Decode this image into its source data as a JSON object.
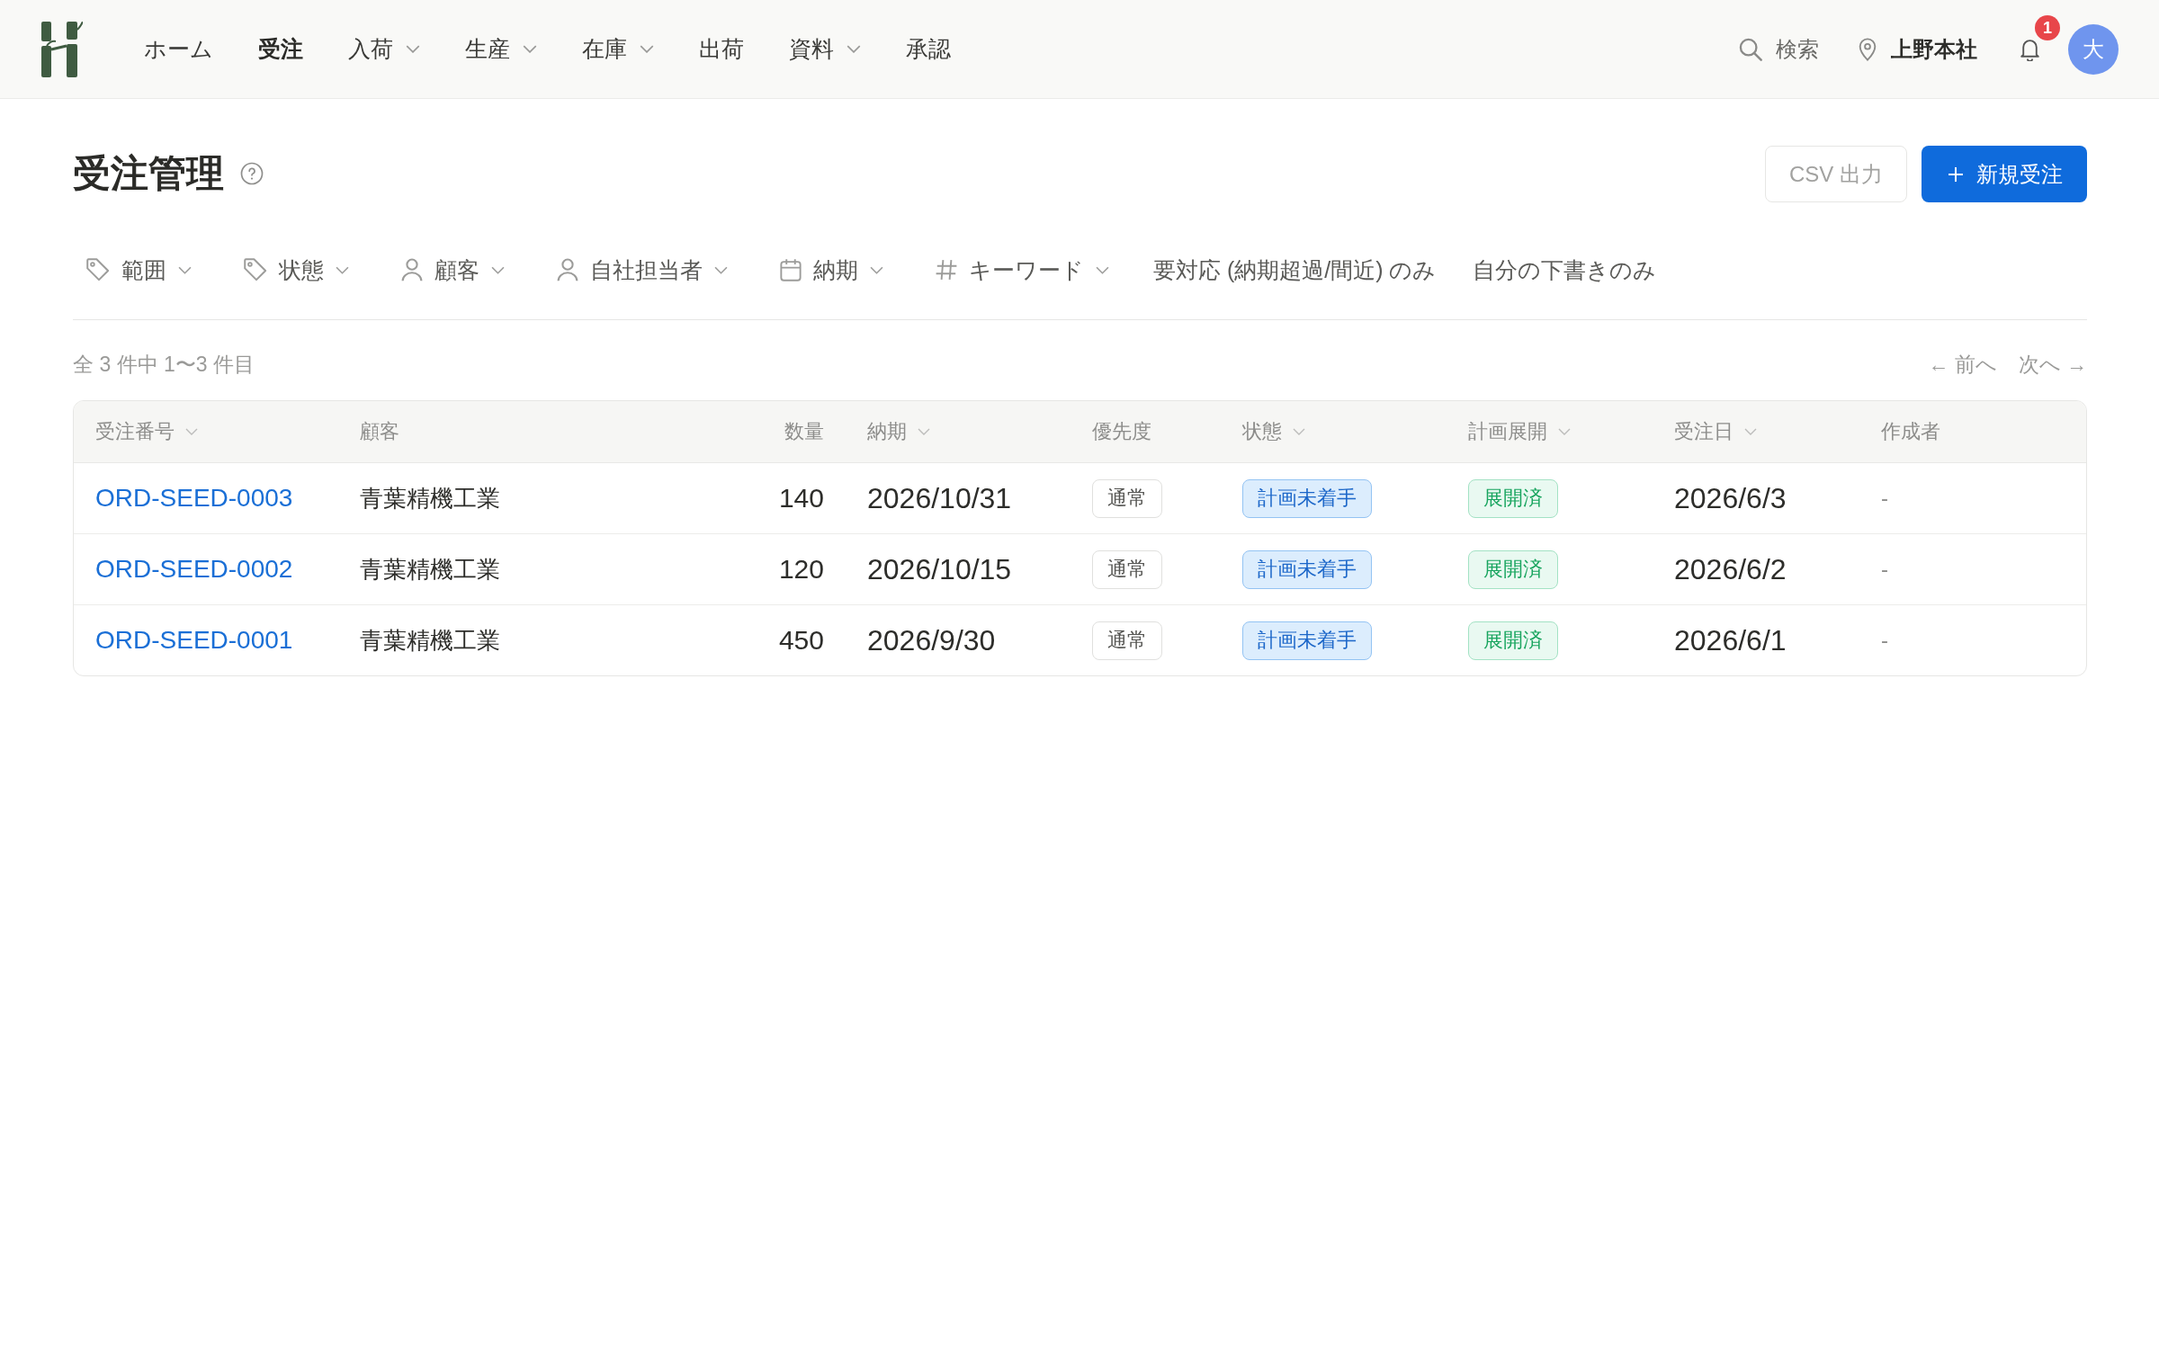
{
  "nav": [
    {
      "label": "ホーム",
      "selected": false,
      "dropdown": false
    },
    {
      "label": "受注",
      "selected": true,
      "dropdown": false
    },
    {
      "label": "入荷",
      "selected": false,
      "dropdown": true
    },
    {
      "label": "生産",
      "selected": false,
      "dropdown": true
    },
    {
      "label": "在庫",
      "selected": false,
      "dropdown": true
    },
    {
      "label": "出荷",
      "selected": false,
      "dropdown": false
    },
    {
      "label": "資料",
      "selected": false,
      "dropdown": true
    },
    {
      "label": "承認",
      "selected": false,
      "dropdown": false
    }
  ],
  "header_tools": {
    "search_label": "検索",
    "location": "上野本社",
    "notification_count": "1",
    "avatar": "大"
  },
  "page": {
    "title": "受注管理",
    "actions": [
      {
        "label": "CSV 出力",
        "kind": "secondary",
        "disabled": true
      },
      {
        "label": "新規受注",
        "kind": "primary",
        "disabled": false
      }
    ]
  },
  "filters": [
    {
      "label": "範囲",
      "kind": "dropdown"
    },
    {
      "label": "状態",
      "kind": "dropdown"
    },
    {
      "label": "顧客",
      "kind": "dropdown"
    },
    {
      "label": "自社担当者",
      "kind": "dropdown"
    },
    {
      "label": "納期",
      "kind": "dropdown"
    },
    {
      "label": "キーワード",
      "kind": "dropdown"
    },
    {
      "label": "要対応 (納期超過/間近) のみ",
      "kind": "toggle"
    },
    {
      "label": "自分の下書きのみ",
      "kind": "toggle"
    }
  ],
  "results": {
    "summary": "全 3 件中 1〜3 件目",
    "prev": "← 前へ",
    "next": "次へ →"
  },
  "table": {
    "columns": [
      {
        "label": "受注番号",
        "sortable": true
      },
      {
        "label": "顧客",
        "sortable": false
      },
      {
        "label": "数量",
        "sortable": false
      },
      {
        "label": "納期",
        "sortable": true
      },
      {
        "label": "優先度",
        "sortable": false
      },
      {
        "label": "状態",
        "sortable": true
      },
      {
        "label": "計画展開",
        "sortable": true
      },
      {
        "label": "受注日",
        "sortable": true
      },
      {
        "label": "作成者",
        "sortable": false
      }
    ],
    "rows": [
      {
        "order_no": "ORD-SEED-0003",
        "customer": "青葉精機工業",
        "quantity": "140",
        "due_date": "2026/10/31",
        "priority": "通常",
        "status": "計画未着手",
        "plan": "展開済",
        "order_date": "2026/6/3",
        "creator": "-"
      },
      {
        "order_no": "ORD-SEED-0002",
        "customer": "青葉精機工業",
        "quantity": "120",
        "due_date": "2026/10/15",
        "priority": "通常",
        "status": "計画未着手",
        "plan": "展開済",
        "order_date": "2026/6/2",
        "creator": "-"
      },
      {
        "order_no": "ORD-SEED-0001",
        "customer": "青葉精機工業",
        "quantity": "450",
        "due_date": "2026/9/30",
        "priority": "通常",
        "status": "計画未着手",
        "plan": "展開済",
        "order_date": "2026/6/1",
        "creator": "-"
      }
    ]
  }
}
